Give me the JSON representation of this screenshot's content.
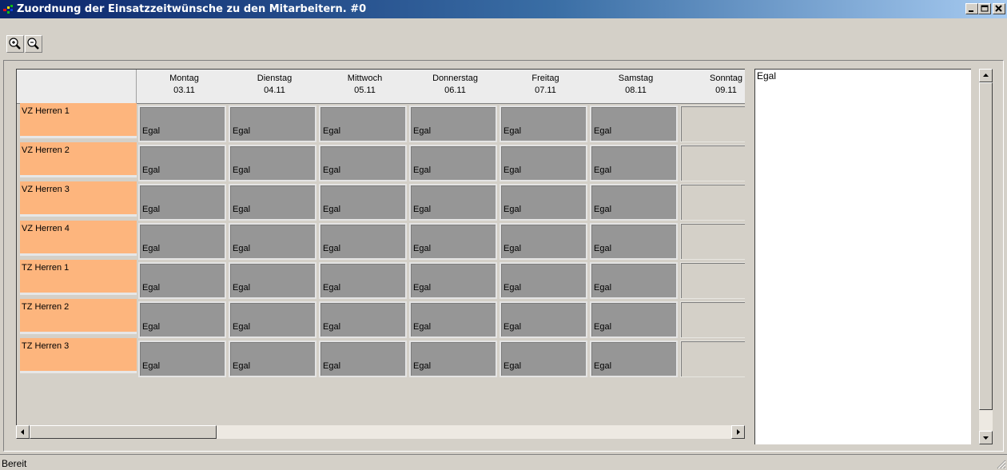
{
  "window": {
    "title": "Zuordnung der Einsatzzeitwünsche zu den Mitarbeitern. #0",
    "minimize": "_",
    "maximize": "□",
    "close": "✕"
  },
  "toolbar": {
    "buttons": [
      {
        "icon": "zoom-in-icon"
      },
      {
        "icon": "zoom-out-icon"
      }
    ]
  },
  "grid": {
    "days": [
      {
        "name": "Montag",
        "date": "03.11"
      },
      {
        "name": "Dienstag",
        "date": "04.11"
      },
      {
        "name": "Mittwoch",
        "date": "05.11"
      },
      {
        "name": "Donnerstag",
        "date": "06.11"
      },
      {
        "name": "Freitag",
        "date": "07.11"
      },
      {
        "name": "Samstag",
        "date": "08.11"
      },
      {
        "name": "Sonntag",
        "date": "09.11"
      }
    ],
    "rows": [
      {
        "label": "VZ Herren 1",
        "cells": [
          "Egal",
          "Egal",
          "Egal",
          "Egal",
          "Egal",
          "Egal",
          ""
        ]
      },
      {
        "label": "VZ Herren 2",
        "cells": [
          "Egal",
          "Egal",
          "Egal",
          "Egal",
          "Egal",
          "Egal",
          ""
        ]
      },
      {
        "label": "VZ Herren 3",
        "cells": [
          "Egal",
          "Egal",
          "Egal",
          "Egal",
          "Egal",
          "Egal",
          ""
        ]
      },
      {
        "label": "VZ Herren 4",
        "cells": [
          "Egal",
          "Egal",
          "Egal",
          "Egal",
          "Egal",
          "Egal",
          ""
        ]
      },
      {
        "label": "TZ Herren 1",
        "cells": [
          "Egal",
          "Egal",
          "Egal",
          "Egal",
          "Egal",
          "Egal",
          ""
        ]
      },
      {
        "label": "TZ Herren 2",
        "cells": [
          "Egal",
          "Egal",
          "Egal",
          "Egal",
          "Egal",
          "Egal",
          ""
        ]
      },
      {
        "label": "TZ Herren 3",
        "cells": [
          "Egal",
          "Egal",
          "Egal",
          "Egal",
          "Egal",
          "Egal",
          ""
        ]
      }
    ]
  },
  "detail": {
    "text": "Egal"
  },
  "status": {
    "text": "Bereit"
  },
  "colors": {
    "row_label": "#fdb57d",
    "cell": "#969696",
    "title_start": "#0a246a",
    "title_end": "#a6caf0"
  }
}
